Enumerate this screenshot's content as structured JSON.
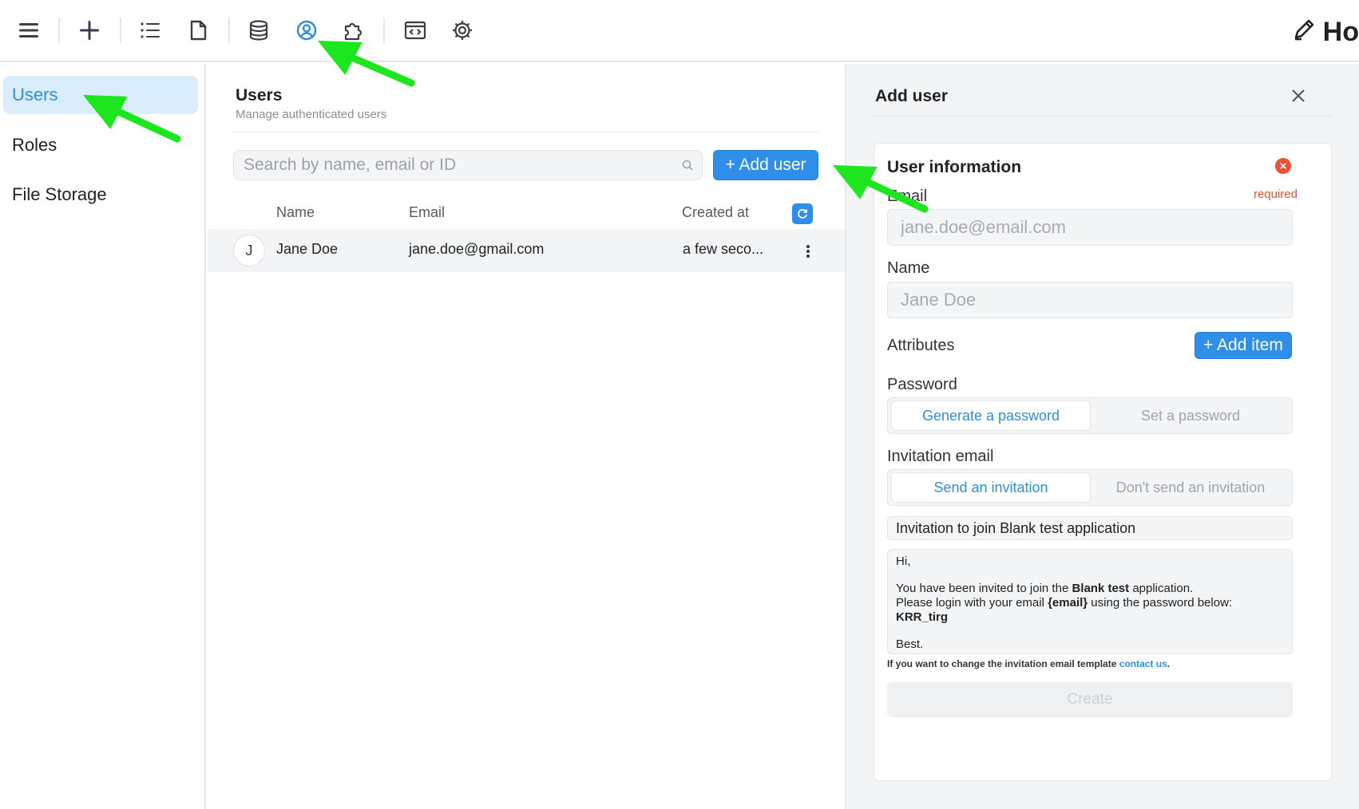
{
  "toolbar": {
    "icons": [
      "menu-icon",
      "plus-icon",
      "list-icon",
      "document-icon",
      "database-icon",
      "user-circle-icon",
      "puzzle-icon",
      "code-window-icon",
      "gear-icon"
    ],
    "active_icon": "user-circle-icon",
    "right_label": "Ho"
  },
  "sidebar": {
    "items": [
      {
        "label": "Users",
        "active": true
      },
      {
        "label": "Roles",
        "active": false
      },
      {
        "label": "File Storage",
        "active": false
      }
    ]
  },
  "main": {
    "title": "Users",
    "subtitle": "Manage authenticated users",
    "search_placeholder": "Search by name, email or ID",
    "add_user_label": "+ Add user",
    "columns": [
      "Name",
      "Email",
      "Created at"
    ],
    "rows": [
      {
        "avatar": "J",
        "name": "Jane Doe",
        "email": "jane.doe@gmail.com",
        "created": "a few seco..."
      }
    ]
  },
  "panel": {
    "title": "Add user",
    "section_title": "User information",
    "email_label": "Email",
    "required_text": "required",
    "email_placeholder": "jane.doe@email.com",
    "name_label": "Name",
    "name_placeholder": "Jane Doe",
    "attributes_label": "Attributes",
    "add_item_label": "+ Add item",
    "password_label": "Password",
    "password_options": [
      "Generate a password",
      "Set a password"
    ],
    "invitation_label": "Invitation email",
    "invitation_options": [
      "Send an invitation",
      "Don't send an invitation"
    ],
    "invitation_subject": "Invitation to join Blank test application",
    "email_body": {
      "greeting": "Hi,",
      "line1_pre": "You have been invited to join the ",
      "line1_bold": "Blank test",
      "line1_post": " application.",
      "line2_pre": "Please login with your email ",
      "line2_bold": "{email}",
      "line2_post": " using the password below:",
      "password": "KRR_tirg",
      "signoff": "Best."
    },
    "note_pre": "If you want to change the invitation email template ",
    "note_link": "contact us",
    "note_post": ".",
    "create_label": "Create"
  },
  "colors": {
    "accent": "#2f8fe8",
    "active_bg": "#d9edfc",
    "error": "#ea4f38",
    "annotation_arrow": "#1ee61e"
  }
}
